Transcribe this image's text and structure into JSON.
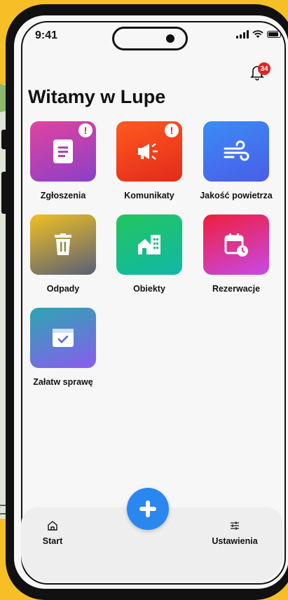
{
  "status_bar": {
    "time": "9:41"
  },
  "header": {
    "title": "Witamy w Lupe",
    "notification_count": "34"
  },
  "tiles": [
    {
      "label": "Zgłoszenia",
      "icon": "document-icon",
      "alert": "!"
    },
    {
      "label": "Komunikaty",
      "icon": "megaphone-icon",
      "alert": "!"
    },
    {
      "label": "Jakość powietrza",
      "icon": "wind-icon"
    },
    {
      "label": "Odpady",
      "icon": "trash-icon"
    },
    {
      "label": "Obiekty",
      "icon": "buildings-icon"
    },
    {
      "label": "Rezerwacje",
      "icon": "calendar-clock-icon"
    },
    {
      "label": "Załatw sprawę",
      "icon": "browser-check-icon"
    }
  ],
  "bottom_nav": {
    "start_label": "Start",
    "settings_label": "Ustawienia",
    "fab_icon": "plus-icon"
  },
  "colors": {
    "background": "#f6bf26",
    "fab": "#2b87f0",
    "badge": "#e02424"
  }
}
